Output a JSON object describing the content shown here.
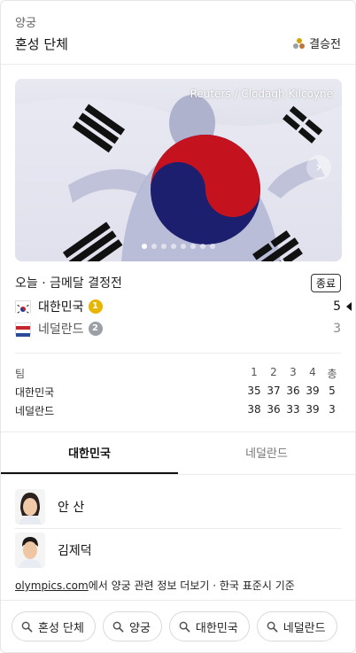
{
  "header": {
    "sport": "양궁",
    "event": "혼성 단체",
    "stage": "결승전",
    "medal_icon": "medal-dots-icon"
  },
  "photo": {
    "credit": "Reuters / Clodagh Kilcoyne",
    "page_count": 8,
    "active_page": 1,
    "next_icon": "chevron-right-icon"
  },
  "match": {
    "label": "오늘 · 금메달 결정전",
    "status": "종료"
  },
  "teams": [
    {
      "name": "대한민국",
      "rank": "1",
      "score": "5",
      "flag": "flag-korea-icon",
      "rank_color": "#e8b500"
    },
    {
      "name": "네덜란드",
      "rank": "2",
      "score": "3",
      "flag": "flag-netherlands-icon",
      "rank_color": "#9aa0a6"
    }
  ],
  "table": {
    "header": {
      "team": "팀",
      "sets": [
        "1",
        "2",
        "3",
        "4",
        "총"
      ]
    },
    "rows": [
      {
        "team": "대한민국",
        "values": [
          "35",
          "37",
          "36",
          "39",
          "5"
        ]
      },
      {
        "team": "네덜란드",
        "values": [
          "38",
          "36",
          "33",
          "39",
          "3"
        ]
      }
    ]
  },
  "tabs": [
    {
      "label": "대한민국",
      "active": true
    },
    {
      "label": "네덜란드",
      "active": false
    }
  ],
  "players": [
    {
      "name": "안 산"
    },
    {
      "name": "김제덕"
    }
  ],
  "source": {
    "link": "olympics.com",
    "text": "에서 양궁 관련 정보 더보기 · 한국 표준시 기준"
  },
  "chips": [
    {
      "label": "혼성 단체"
    },
    {
      "label": "양궁"
    },
    {
      "label": "대한민국"
    },
    {
      "label": "네덜란드"
    }
  ]
}
